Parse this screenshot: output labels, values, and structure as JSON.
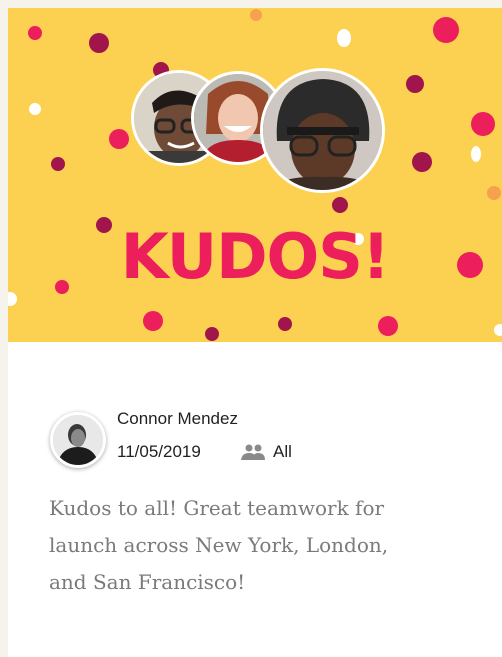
{
  "banner": {
    "headline": "KUDOS!",
    "background_color": "#fcd152",
    "headline_color": "#ec1e5c",
    "illustration": "confetti-dots",
    "avatars": [
      "person-with-glasses-smiling",
      "woman-red-hair-smiling",
      "person-beanie-glasses"
    ]
  },
  "post": {
    "author_name": "Connor Mendez",
    "date": "11/05/2019",
    "audience_icon": "people-icon",
    "audience_label": "All",
    "message": "Kudos to all! Great teamwork for\nlaunch across New York, London,\nand San Francisco!"
  }
}
